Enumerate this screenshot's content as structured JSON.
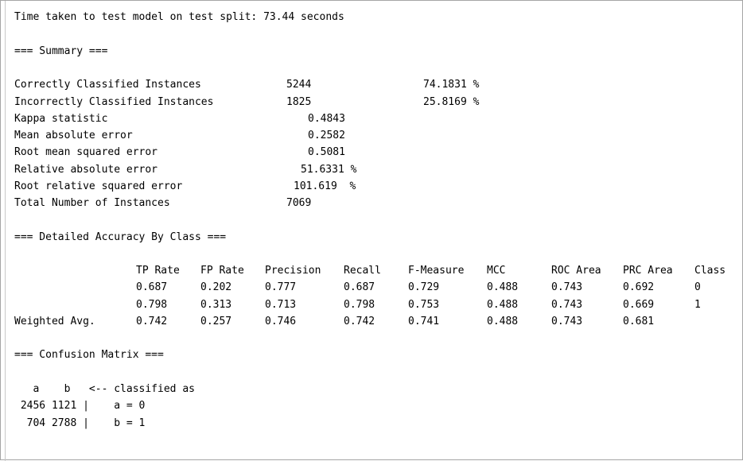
{
  "output": {
    "time_line": "Time taken to test model on test split: 73.44 seconds",
    "summary_header": "=== Summary ===",
    "summary": [
      {
        "label": "Correctly Classified Instances",
        "value": "5244",
        "percent": "74.1831 %"
      },
      {
        "label": "Incorrectly Classified Instances",
        "value": "1825",
        "percent": "25.8169 %"
      },
      {
        "label": "Kappa statistic",
        "value": "0.4843"
      },
      {
        "label": "Mean absolute error",
        "value": "0.2582"
      },
      {
        "label": "Root mean squared error",
        "value": "0.5081"
      },
      {
        "label": "Relative absolute error",
        "value": "51.6331 %"
      },
      {
        "label": "Root relative squared error",
        "value": "101.619  %"
      },
      {
        "label": "Total Number of Instances",
        "value": "7069"
      }
    ],
    "accuracy_header": "=== Detailed Accuracy By Class ===",
    "accuracy_columns": [
      "TP Rate",
      "FP Rate",
      "Precision",
      "Recall",
      "F-Measure",
      "MCC",
      "ROC Area",
      "PRC Area",
      "Class"
    ],
    "accuracy_rows": [
      {
        "label": "",
        "values": [
          "0.687",
          "0.202",
          "0.777",
          "0.687",
          "0.729",
          "0.488",
          "0.743",
          "0.692",
          "0"
        ]
      },
      {
        "label": "",
        "values": [
          "0.798",
          "0.313",
          "0.713",
          "0.798",
          "0.753",
          "0.488",
          "0.743",
          "0.669",
          "1"
        ]
      },
      {
        "label": "Weighted Avg.",
        "values": [
          "0.742",
          "0.257",
          "0.746",
          "0.742",
          "0.741",
          "0.488",
          "0.743",
          "0.681",
          ""
        ]
      }
    ],
    "confusion_header": "=== Confusion Matrix ===",
    "confusion_lines": [
      "   a    b   <-- classified as",
      " 2456 1121 |    a = 0",
      "  704 2788 |    b = 1"
    ]
  }
}
